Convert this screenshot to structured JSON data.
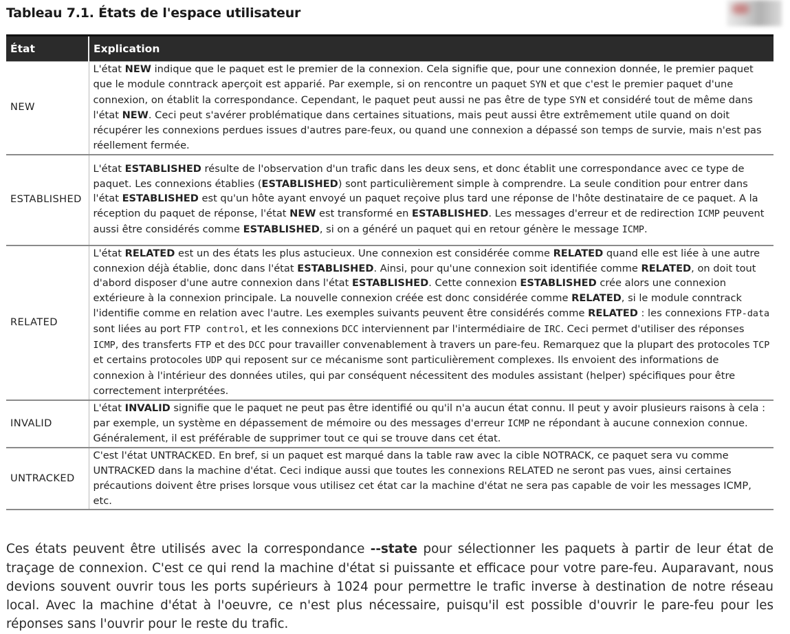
{
  "title": "Tableau 7.1. États de l'espace utilisateur",
  "table": {
    "headers": [
      "État",
      "Explication"
    ],
    "rows": [
      {
        "state": "NEW",
        "explanation": [
          {
            "t": "L'état "
          },
          {
            "b": "NEW"
          },
          {
            "t": " indique que le paquet est le premier de la connexion. Cela signifie que, pour une connexion donnée, le premier paquet que le module conntrack aperçoit est apparié. Par exemple, si on rencontre un paquet "
          },
          {
            "m": "SYN"
          },
          {
            "t": " et que c'est le premier paquet d'une connexion, on établit la correspondance. Cependant, le paquet peut aussi ne pas être de type "
          },
          {
            "m": "SYN"
          },
          {
            "t": " et considéré tout de même dans l'état "
          },
          {
            "b": "NEW"
          },
          {
            "t": ". Ceci peut s'avérer problématique dans certaines situations, mais peut aussi être extrêmement utile quand on doit récupérer les connexions perdues issues d'autres pare-feux, ou quand une connexion a dépassé son temps de survie, mais n'est pas réellement fermée."
          }
        ]
      },
      {
        "state": "ESTABLISHED",
        "explanation": [
          {
            "t": "L'état "
          },
          {
            "b": "ESTABLISHED"
          },
          {
            "t": " résulte de l'observation d'un trafic dans les deux sens, et donc établit une correspondance avec ce type de paquet. Les connexions établies ("
          },
          {
            "b": "ESTABLISHED"
          },
          {
            "t": ") sont particulièrement simple à comprendre. La seule condition pour entrer dans l'état "
          },
          {
            "b": "ESTABLISHED"
          },
          {
            "t": " est qu'un hôte ayant envoyé un paquet reçoive plus tard une réponse de l'hôte destinataire de ce paquet. A la réception du paquet de réponse, l'état "
          },
          {
            "b": "NEW"
          },
          {
            "t": " est transformé en "
          },
          {
            "b": "ESTABLISHED"
          },
          {
            "t": ". Les messages d'erreur et de redirection "
          },
          {
            "m": "ICMP"
          },
          {
            "t": " peuvent aussi être considérés comme "
          },
          {
            "b": "ESTABLISHED"
          },
          {
            "t": ", si on a généré un paquet qui en retour génère le message "
          },
          {
            "m": "ICMP"
          },
          {
            "t": "."
          }
        ]
      },
      {
        "state": "RELATED",
        "explanation": [
          {
            "t": "L'état "
          },
          {
            "b": "RELATED"
          },
          {
            "t": " est un des états les plus astucieux. Une connexion est considérée comme "
          },
          {
            "b": "RELATED"
          },
          {
            "t": " quand elle est liée à une autre connexion déjà établie, donc dans l'état "
          },
          {
            "b": "ESTABLISHED"
          },
          {
            "t": ". Ainsi, pour qu'une connexion soit identifiée comme "
          },
          {
            "b": "RELATED"
          },
          {
            "t": ", on doit tout d'abord disposer d'une autre connexion dans l'état "
          },
          {
            "b": "ESTABLISHED"
          },
          {
            "t": ". Cette connexion "
          },
          {
            "b": "ESTABLISHED"
          },
          {
            "t": " crée alors une connexion extérieure à la connexion principale. La nouvelle connexion créée est donc considérée comme "
          },
          {
            "b": "RELATED"
          },
          {
            "t": ", si le module conntrack l'identifie comme en relation avec l'autre. Les exemples suivants peuvent être considérés comme "
          },
          {
            "b": "RELATED"
          },
          {
            "t": " : les connexions "
          },
          {
            "m": "FTP-data"
          },
          {
            "t": " sont liées au port "
          },
          {
            "m": "FTP control"
          },
          {
            "t": ", et les connexions "
          },
          {
            "m": "DCC"
          },
          {
            "t": " interviennent par l'intermédiaire de "
          },
          {
            "m": "IRC"
          },
          {
            "t": ". Ceci permet d'utiliser des réponses "
          },
          {
            "m": "ICMP"
          },
          {
            "t": ", des transferts "
          },
          {
            "m": "FTP"
          },
          {
            "t": " et des "
          },
          {
            "m": "DCC"
          },
          {
            "t": " pour travailler convenablement à travers un pare-feu. Remarquez que la plupart des protocoles "
          },
          {
            "m": "TCP"
          },
          {
            "t": " et certains protocoles "
          },
          {
            "m": "UDP"
          },
          {
            "t": " qui reposent sur ce mécanisme sont particulièrement complexes. Ils envoient des informations de connexion à l'intérieur des données utiles, qui par conséquent nécessitent des modules assistant (helper) spécifiques pour être correctement interprétées."
          }
        ]
      },
      {
        "state": "INVALID",
        "explanation": [
          {
            "t": "L'état "
          },
          {
            "b": "INVALID"
          },
          {
            "t": " signifie que le paquet ne peut pas être identifié ou qu'il n'a aucun état connu. Il peut y avoir plusieurs raisons à cela : par exemple, un système en dépassement de mémoire ou des messages d'erreur "
          },
          {
            "m": "ICMP"
          },
          {
            "t": " ne répondant à aucune connexion connue. Généralement, il est préférable de supprimer tout ce qui se trouve dans cet état."
          }
        ]
      },
      {
        "state": "UNTRACKED",
        "explanation": [
          {
            "t": "C'est l'état UNTRACKED. En bref, si un paquet est marqué dans la table raw avec la cible NOTRACK, ce paquet sera vu comme UNTRACKED dans la machine d'état. Ceci indique aussi que toutes les connexions RELATED ne seront pas vues, ainsi certaines précautions doivent être prises lorsque vous utilisez cet état car la machine d'état ne sera pas capable de voir les messages ICMP, etc."
          }
        ]
      }
    ]
  },
  "paragraph": [
    {
      "t": "Ces états peuvent être utilisés avec la correspondance "
    },
    {
      "b": "--state"
    },
    {
      "t": " pour sélectionner les paquets à partir de leur état de traçage de connexion. C'est ce qui rend la machine d'état si puissante et efficace pour votre pare-feu. Auparavant, nous devions souvent ouvrir tous les ports supérieurs à 1024 pour permettre le trafic inverse à destination de notre réseau local. Avec la machine d'état à l'oeuvre, ce n'est plus nécessaire, puisqu'il est possible d'ouvrir le pare-feu pour les réponses sans l'ouvrir pour le reste du trafic."
    }
  ]
}
